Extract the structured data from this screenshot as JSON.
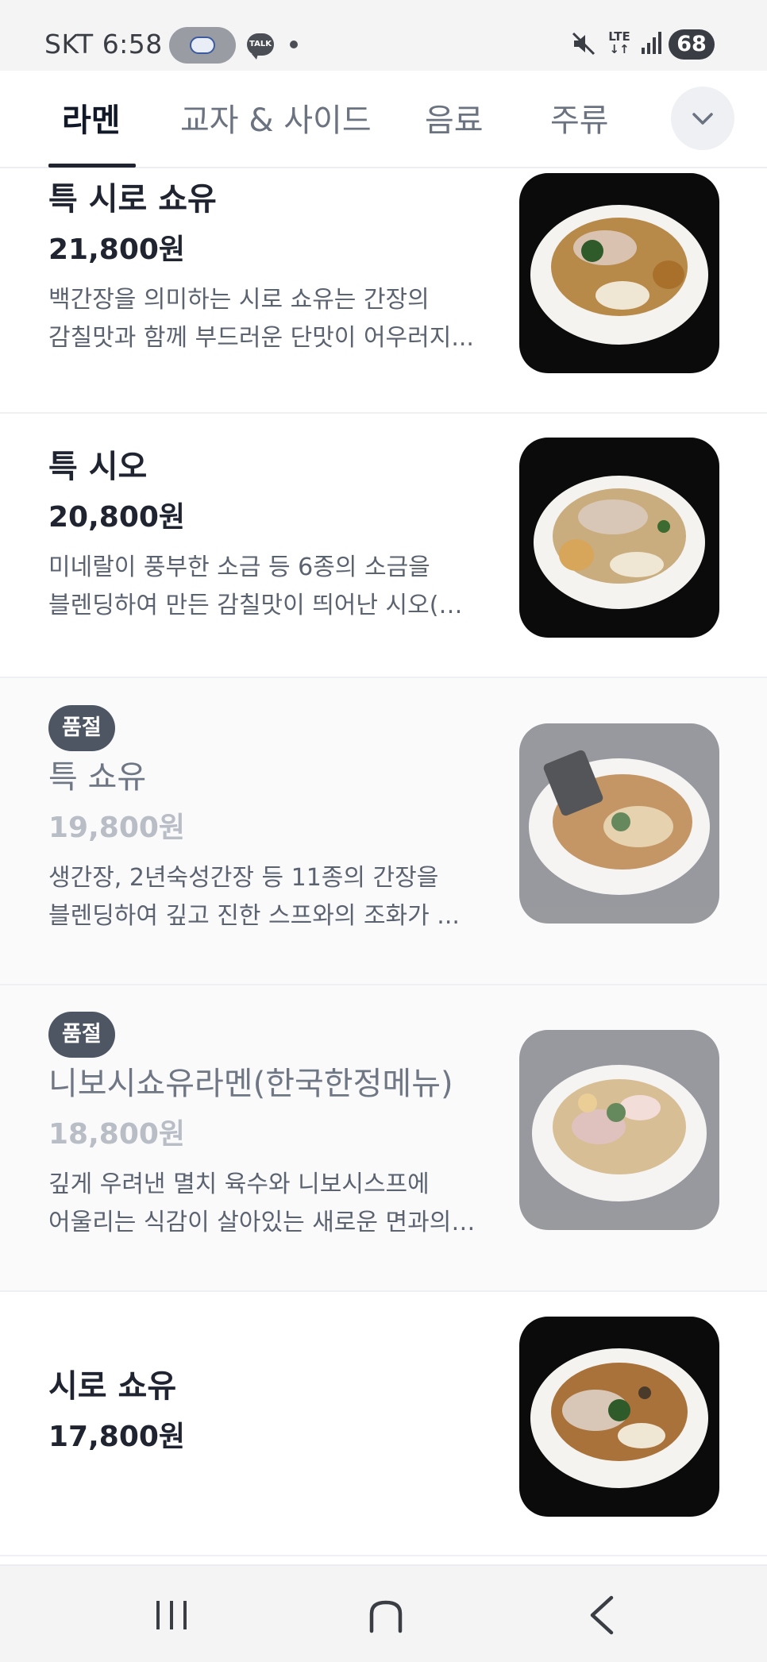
{
  "status_bar": {
    "carrier": "SKT",
    "time": "6:58",
    "talk_label": "TALK",
    "network": "LTE",
    "battery": "68"
  },
  "tabs": [
    {
      "label": "라멘",
      "active": true
    },
    {
      "label": "교자 & 사이드",
      "active": false
    },
    {
      "label": "음료",
      "active": false
    },
    {
      "label": "주류",
      "active": false
    }
  ],
  "tab_expand_icon": "chevron-down-icon",
  "soldout_label": "품절",
  "menu_items": [
    {
      "name": "특 시로 쇼유",
      "price": "21,800원",
      "desc_line1": "백간장을 의미하는 시로 쇼유는 간장의",
      "desc_line2": "감칠맛과 함께 부드러운 단맛이 어우러지...",
      "sold_out": false
    },
    {
      "name": "특 시오",
      "price": "20,800원",
      "desc_line1": "미네랄이 풍부한 소금 등 6종의 소금을",
      "desc_line2": "블렌딩하여 만든 감칠맛이 띄어난 시오(소...",
      "sold_out": false
    },
    {
      "name": "특 쇼유",
      "price": "19,800원",
      "desc_line1": "생간장, 2년숙성간장 등 11종의 간장을",
      "desc_line2": "블렌딩하여 깊고 진한 스프와의 조화가 ...",
      "sold_out": true
    },
    {
      "name": "니보시쇼유라멘(한국한정메뉴)",
      "price": "18,800원",
      "desc_line1": "깊게 우려낸 멸치 육수와 니보시스프에",
      "desc_line2": "어울리는 식감이 살아있는 새로운 면과의 ...",
      "sold_out": true
    },
    {
      "name": "시로 쇼유",
      "price": "17,800원",
      "sold_out": false
    }
  ],
  "colors": {
    "accent": "#1f2430",
    "soldout_badge": "#4e5664",
    "muted_price": "#b8bdc6"
  },
  "nav_icons": [
    "recent-apps-icon",
    "home-icon",
    "back-icon"
  ]
}
